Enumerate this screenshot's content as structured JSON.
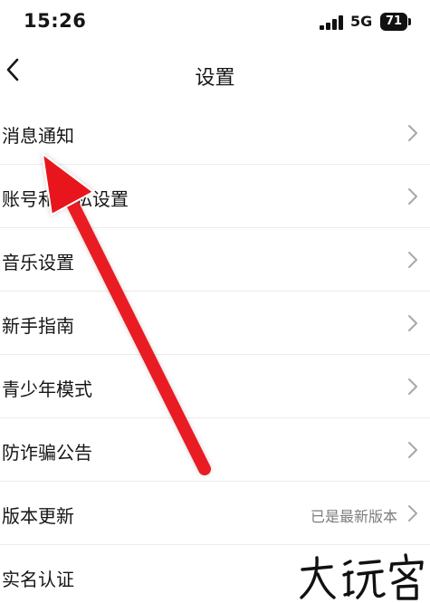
{
  "status_bar": {
    "time": "15:26",
    "network": "5G",
    "battery": "71"
  },
  "nav": {
    "back_icon": "chevron-left-icon",
    "title": "设置"
  },
  "settings": [
    {
      "label": "消息通知",
      "value": ""
    },
    {
      "label": "账号和隐私设置",
      "value": ""
    },
    {
      "label": "音乐设置",
      "value": ""
    },
    {
      "label": "新手指南",
      "value": ""
    },
    {
      "label": "青少年模式",
      "value": ""
    },
    {
      "label": "防诈骗公告",
      "value": ""
    },
    {
      "label": "版本更新",
      "value": "已是最新版本"
    },
    {
      "label": "实名认证",
      "value": ""
    }
  ],
  "annotation": {
    "arrow_color": "#e8141c"
  },
  "watermark": {
    "text": "大玩客"
  }
}
